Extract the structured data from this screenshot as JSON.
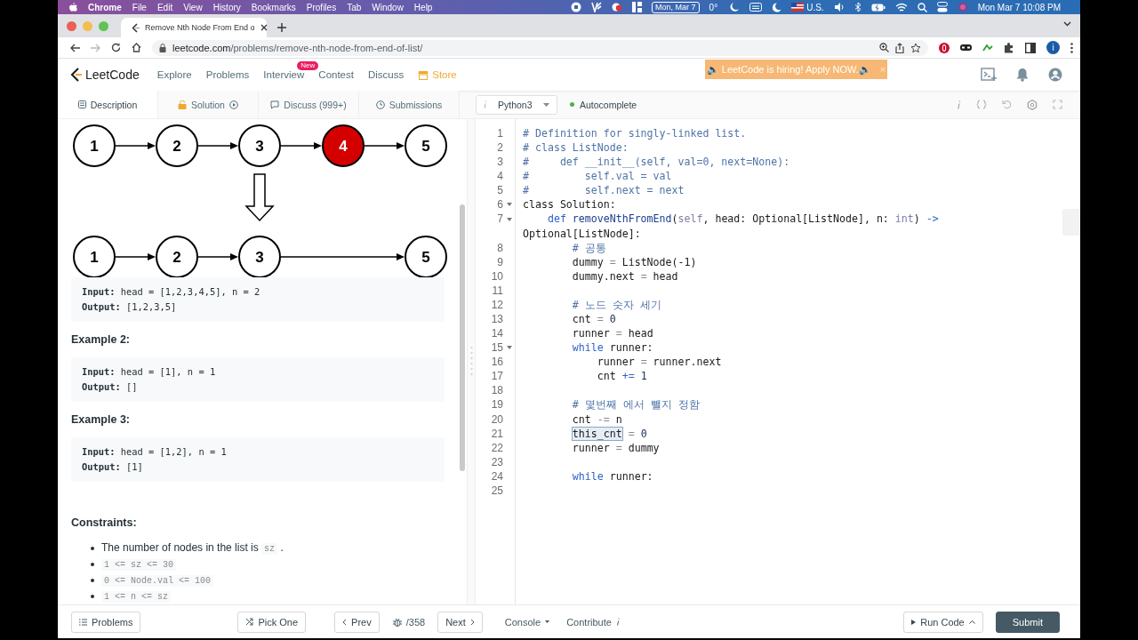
{
  "menubar": {
    "app": "Chrome",
    "menus": [
      "File",
      "Edit",
      "View",
      "History",
      "Bookmarks",
      "Profiles",
      "Tab",
      "Window",
      "Help"
    ],
    "date_badge": "Mon, Mar 7",
    "weather": "0°",
    "input_source": "U.S.",
    "clock": "Mon Mar 7  10:08 PM"
  },
  "browser": {
    "tab_title": "Remove Nth Node From End o",
    "url_host": "leetcode.com",
    "url_path": "/problems/remove-nth-node-from-end-of-list/",
    "profile_initial": "i"
  },
  "site_nav": {
    "logo": "LeetCode",
    "links": [
      {
        "label": "Explore",
        "kind": "link"
      },
      {
        "label": "Problems",
        "kind": "link"
      },
      {
        "label": "Interview",
        "kind": "link",
        "badge": "New"
      },
      {
        "label": "Contest",
        "kind": "link"
      },
      {
        "label": "Discuss",
        "kind": "link"
      },
      {
        "label": "Store",
        "kind": "store"
      }
    ],
    "banner": "🔈 LeetCode is hiring! Apply NOW.🔈",
    "banner_close": "×"
  },
  "panel_tabs": [
    {
      "label": "Description",
      "kind": "description",
      "selected": true
    },
    {
      "label": "Solution",
      "kind": "solution",
      "selected": false
    },
    {
      "label": "Discuss (999+)",
      "kind": "discuss",
      "selected": false
    },
    {
      "label": "Submissions",
      "kind": "submissions",
      "selected": false
    }
  ],
  "editor_toolbar": {
    "language": "Python3",
    "autocomplete": {
      "label": "Autocomplete",
      "on": true
    }
  },
  "diagram": {
    "top": [
      {
        "kind": "node",
        "label": "1",
        "highlighted": false
      },
      {
        "kind": "node",
        "label": "2",
        "highlighted": false
      },
      {
        "kind": "node",
        "label": "3",
        "highlighted": false
      },
      {
        "kind": "node",
        "label": "4",
        "highlighted": true
      },
      {
        "kind": "node",
        "label": "5",
        "highlighted": false
      }
    ],
    "bottom": [
      {
        "kind": "node",
        "label": "1"
      },
      {
        "kind": "node",
        "label": "2"
      },
      {
        "kind": "node",
        "label": "3"
      },
      {
        "kind": "gap"
      },
      {
        "kind": "node",
        "label": "5"
      }
    ]
  },
  "examples": [
    {
      "lines": [
        "**Input:** head = [1,2,3,4,5], n = 2",
        "**Output:** [1,2,3,5]"
      ]
    },
    {
      "heading": "Example 2:",
      "lines": [
        "**Input:** head = [1], n = 1",
        "**Output:** []"
      ]
    },
    {
      "heading": "Example 3:",
      "lines": [
        "**Input:** head = [1,2], n = 1",
        "**Output:** [1]"
      ]
    }
  ],
  "constraints": {
    "heading": "Constraints:",
    "items": [
      {
        "parts": [
          {
            "text": "The number of nodes in the list is "
          },
          {
            "code": "sz"
          },
          {
            "text": " ."
          }
        ]
      },
      {
        "parts": [
          {
            "code": "1 <= sz <= 30"
          }
        ]
      },
      {
        "parts": [
          {
            "code": "0 <= Node.val <= 100"
          }
        ]
      },
      {
        "parts": [
          {
            "code": "1 <= n <= sz"
          }
        ]
      }
    ]
  },
  "code": {
    "lines": [
      {
        "number": "1",
        "fold": false,
        "tokens": [
          {
            "text": "# Definition for singly-linked list.",
            "kind": "comment"
          }
        ]
      },
      {
        "number": "2",
        "fold": false,
        "tokens": [
          {
            "text": "# class ListNode:",
            "kind": "comment"
          }
        ]
      },
      {
        "number": "3",
        "fold": false,
        "tokens": [
          {
            "text": "#     def __init__(self, val=0, next=None):",
            "kind": "comment"
          }
        ]
      },
      {
        "number": "4",
        "fold": false,
        "tokens": [
          {
            "text": "#         self.val = val",
            "kind": "comment"
          }
        ]
      },
      {
        "number": "5",
        "fold": false,
        "tokens": [
          {
            "text": "#         self.next = next",
            "kind": "comment"
          }
        ]
      },
      {
        "number": "6",
        "fold": true,
        "tokens": [
          {
            "text": "class Solution:",
            "kind": "plain"
          }
        ]
      },
      {
        "number": "7",
        "fold": true,
        "tokens": [
          {
            "text": "    def ",
            "kind": "keyword"
          },
          {
            "text": "removeNthFromEnd",
            "kind": "function"
          },
          {
            "text": "(",
            "kind": "plain"
          },
          {
            "text": "self",
            "kind": "builtin"
          },
          {
            "text": ", head: Optional[ListNode], n: ",
            "kind": "plain"
          },
          {
            "text": "int",
            "kind": "builtin"
          },
          {
            "text": ") ",
            "kind": "plain"
          },
          {
            "text": "->",
            "kind": "keyword"
          }
        ],
        "wrap": [
          {
            "text": "Optional[ListNode]:",
            "kind": "plain"
          }
        ]
      },
      {
        "number": "8",
        "fold": false,
        "tokens": [
          {
            "text": "        # 공통",
            "kind": "comment"
          }
        ]
      },
      {
        "number": "9",
        "fold": false,
        "tokens": [
          {
            "text": "        dummy",
            "kind": "plain"
          },
          {
            "text": " = ",
            "kind": "operator"
          },
          {
            "text": "ListNode(-1)",
            "kind": "plain"
          }
        ]
      },
      {
        "number": "10",
        "fold": false,
        "tokens": [
          {
            "text": "        dummy.next",
            "kind": "plain"
          },
          {
            "text": " = ",
            "kind": "operator"
          },
          {
            "text": "head",
            "kind": "plain"
          }
        ]
      },
      {
        "number": "11",
        "fold": false
      },
      {
        "number": "12",
        "fold": false,
        "tokens": [
          {
            "text": "        # 노드 숫자 세기",
            "kind": "comment"
          }
        ]
      },
      {
        "number": "13",
        "fold": false,
        "tokens": [
          {
            "text": "        cnt",
            "kind": "plain"
          },
          {
            "text": " = ",
            "kind": "operator"
          },
          {
            "text": "0",
            "kind": "number"
          }
        ]
      },
      {
        "number": "14",
        "fold": false,
        "tokens": [
          {
            "text": "        runner",
            "kind": "plain"
          },
          {
            "text": " = ",
            "kind": "operator"
          },
          {
            "text": "head",
            "kind": "plain"
          }
        ]
      },
      {
        "number": "15",
        "fold": true,
        "tokens": [
          {
            "text": "        while",
            "kind": "keyword"
          },
          {
            "text": " runner:",
            "kind": "plain"
          }
        ]
      },
      {
        "number": "16",
        "fold": false,
        "tokens": [
          {
            "text": "            runner",
            "kind": "plain"
          },
          {
            "text": " = ",
            "kind": "operator"
          },
          {
            "text": "runner.next",
            "kind": "plain"
          }
        ]
      },
      {
        "number": "17",
        "fold": false,
        "tokens": [
          {
            "text": "            cnt",
            "kind": "plain"
          },
          {
            "text": " += ",
            "kind": "keyword"
          },
          {
            "text": "1",
            "kind": "number"
          }
        ]
      },
      {
        "number": "18",
        "fold": false
      },
      {
        "number": "19",
        "fold": false,
        "tokens": [
          {
            "text": "        # 몇번째 에서 뺄지 정함",
            "kind": "comment"
          }
        ]
      },
      {
        "number": "20",
        "fold": false,
        "tokens": [
          {
            "text": "        cnt",
            "kind": "plain"
          },
          {
            "text": " -= ",
            "kind": "operator"
          },
          {
            "text": "n",
            "kind": "plain"
          }
        ]
      },
      {
        "number": "21",
        "fold": false,
        "tokens": [
          {
            "text": "        this_cnt",
            "kind": "highlight"
          },
          {
            "text": " = ",
            "kind": "operator"
          },
          {
            "text": "0",
            "kind": "number"
          }
        ]
      },
      {
        "number": "22",
        "fold": false,
        "tokens": [
          {
            "text": "        runner",
            "kind": "plain"
          },
          {
            "text": " = ",
            "kind": "operator"
          },
          {
            "text": "dummy",
            "kind": "plain"
          }
        ]
      },
      {
        "number": "23",
        "fold": false
      },
      {
        "number": "24",
        "fold": false,
        "tokens": [
          {
            "text": "        while",
            "kind": "keyword"
          },
          {
            "text": " runner:",
            "kind": "plain"
          }
        ]
      },
      {
        "number": "25",
        "fold": false
      }
    ]
  },
  "bottom_bar": {
    "problems": "Problems",
    "pick_one": "Pick One",
    "prev": "Prev",
    "counter": "/358",
    "next": "Next",
    "console": "Console",
    "contribute": "Contribute",
    "run_code": "Run Code",
    "submit": "Submit"
  }
}
